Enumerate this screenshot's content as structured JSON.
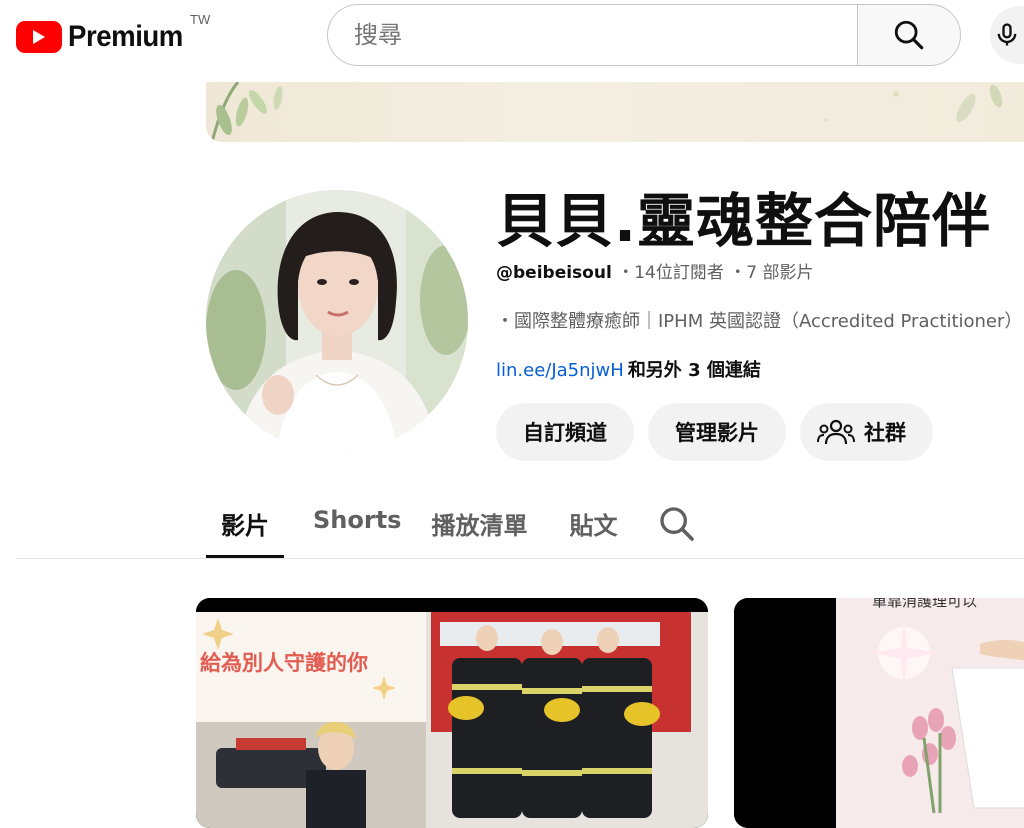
{
  "header": {
    "logo_text": "Premium",
    "region": "TW",
    "search_placeholder": "搜尋"
  },
  "channel": {
    "name": "貝貝.靈魂整合陪伴",
    "handle": "@beibeisoul",
    "subscribers": "14位訂閱者",
    "videos": "7 部影片",
    "description": "・國際整體療癒師｜IPHM 英國認證（Accredited Practitioner）",
    "link": "lin.ee/Ja5njwH",
    "more_links": "和另外 3 個連結"
  },
  "actions": {
    "customize": "自訂頻道",
    "manage": "管理影片",
    "community": "社群"
  },
  "tabs": [
    {
      "label": "影片",
      "active": true
    },
    {
      "label": "Shorts",
      "active": false
    },
    {
      "label": "播放清單",
      "active": false
    },
    {
      "label": "貼文",
      "active": false
    }
  ],
  "videos": [
    {
      "thumb_text": "給為別人守護的你"
    },
    {
      "thumb_text": "單靠消護理可以"
    }
  ],
  "colors": {
    "brand_red": "#ff0000",
    "link_blue": "#065fd4",
    "secondary_text": "#606060",
    "pill_bg": "#f2f2f2"
  }
}
